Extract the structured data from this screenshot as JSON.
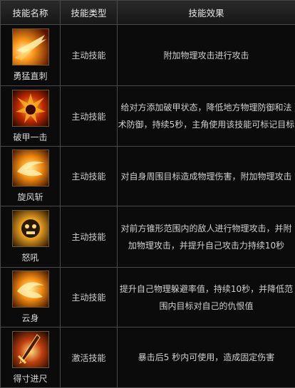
{
  "headers": [
    "技能名称",
    "技能类型",
    "技能效果"
  ],
  "skills": [
    {
      "name": "勇猛直刺",
      "type": "主动技能",
      "effect": "附加物理攻击进行攻击",
      "icon": "charging-thrust-icon"
    },
    {
      "name": "破甲一击",
      "type": "主动技能",
      "effect": "给对方添加破甲状态，降低地方物理防御和法术防御，持续5秒，主角使用该技能可标记目标",
      "icon": "armor-break-icon"
    },
    {
      "name": "旋风斩",
      "type": "主动技能",
      "effect": "对自身周围目标造成物理伤害，附加物理攻击",
      "icon": "whirlwind-slash-icon"
    },
    {
      "name": "怒吼",
      "type": "主动技能",
      "effect": "对前方锥形范围内的敌人进行物理攻击，并附加物理攻击，并提升自己攻击力持续10秒",
      "icon": "roar-icon"
    },
    {
      "name": "云身",
      "type": "主动技能",
      "effect": "提升自己物理躲避率值，持续10秒，并降低范围内目标对自己的仇恨值",
      "icon": "cloud-body-icon"
    },
    {
      "name": "得寸进尺",
      "type": "激活技能",
      "effect": "暴击后5 秒内可使用，造成固定伤害",
      "icon": "press-advantage-icon"
    }
  ]
}
